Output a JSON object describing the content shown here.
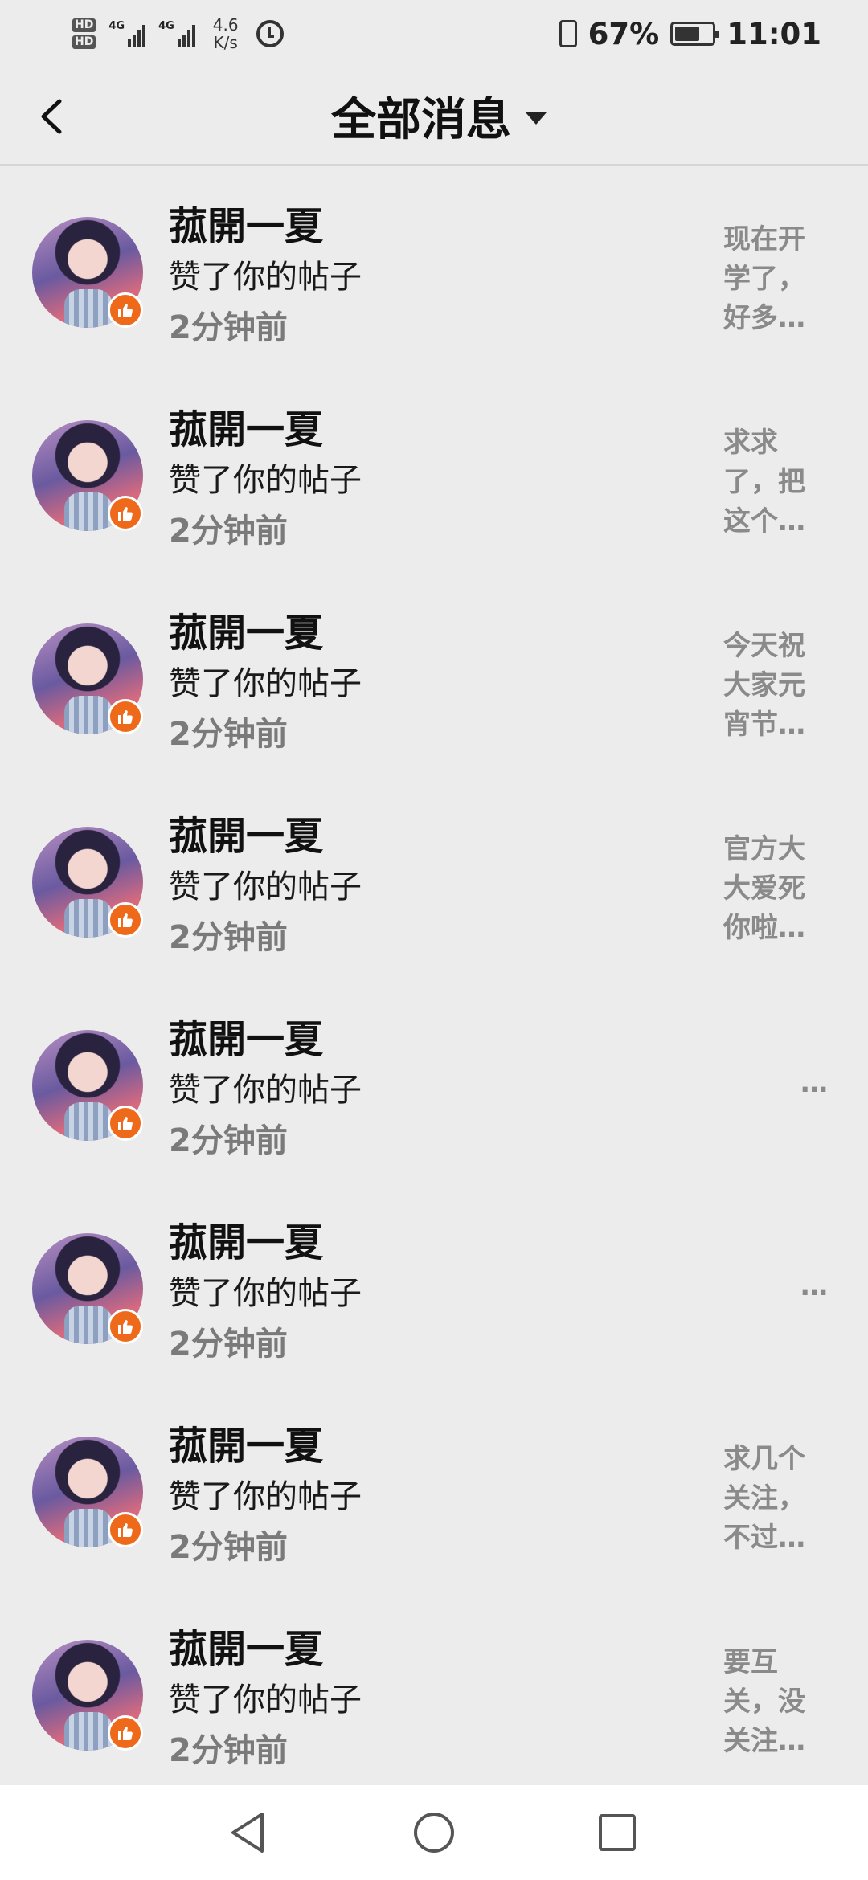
{
  "status_bar": {
    "hd1": "HD",
    "hd2": "HD",
    "net1": "4G",
    "net2": "4G",
    "speed_value": "4.6",
    "speed_unit": "K/s",
    "battery_pct": "67%",
    "battery_level": 0.67,
    "time": "11:01"
  },
  "header": {
    "title": "全部消息"
  },
  "notifications": [
    {
      "name": "菰開一夏",
      "action": "赞了你的帖子",
      "time": "2分钟前",
      "snippet": "现在开学了，好多…"
    },
    {
      "name": "菰開一夏",
      "action": "赞了你的帖子",
      "time": "2分钟前",
      "snippet": "求求了，把这个…"
    },
    {
      "name": "菰開一夏",
      "action": "赞了你的帖子",
      "time": "2分钟前",
      "snippet": "今天祝大家元宵节…"
    },
    {
      "name": "菰開一夏",
      "action": "赞了你的帖子",
      "time": "2分钟前",
      "snippet": "官方大大爱死你啦…"
    },
    {
      "name": "菰開一夏",
      "action": "赞了你的帖子",
      "time": "2分钟前",
      "snippet": "…"
    },
    {
      "name": "菰開一夏",
      "action": "赞了你的帖子",
      "time": "2分钟前",
      "snippet": "…"
    },
    {
      "name": "菰開一夏",
      "action": "赞了你的帖子",
      "time": "2分钟前",
      "snippet": "求几个关注，不过…"
    },
    {
      "name": "菰開一夏",
      "action": "赞了你的帖子",
      "time": "2分钟前",
      "snippet": "要互关，没关注…"
    }
  ],
  "icons": {
    "back": "chevron-left-icon",
    "dropdown": "caret-down-icon",
    "like_badge": "thumbs-up-icon",
    "nav_back": "triangle-back-icon",
    "nav_home": "circle-home-icon",
    "nav_recents": "square-recents-icon"
  },
  "colors": {
    "background": "#ececec",
    "badge": "#ee6a1a",
    "snippet_text": "#8a8a8a",
    "time_text": "#7a7a7a"
  }
}
